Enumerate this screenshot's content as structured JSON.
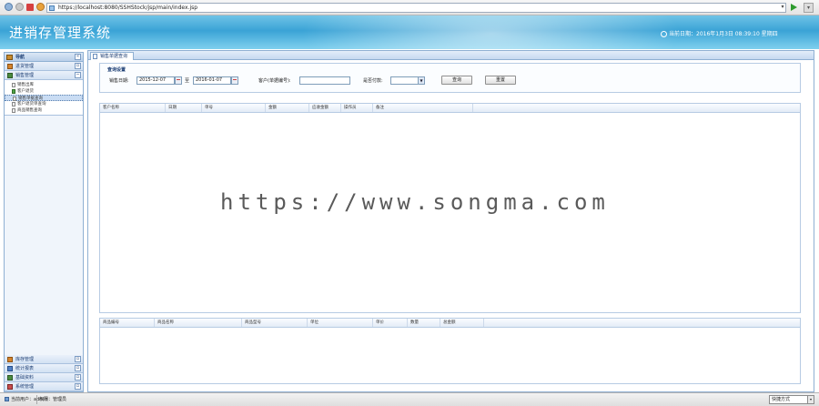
{
  "browser": {
    "url": "https://localhost:8080/SSHStock/jsp/main/index.jsp",
    "dropdown_glyph": "▾",
    "tools_glyph": "▾"
  },
  "header": {
    "title": "进销存管理系统",
    "date_text": "当前日期：2016年1月3日 08:39:10 星期四"
  },
  "sidebar": {
    "title": "导航",
    "collapse_glyph": "«",
    "groups_top": [
      {
        "label": "进货管理",
        "toggle": "▫"
      },
      {
        "label": "销售管理",
        "toggle": "−"
      }
    ],
    "sales_items": [
      {
        "label": "销售出库"
      },
      {
        "label": "客户退货"
      },
      {
        "label": "销售单据查询"
      },
      {
        "label": "客户退货单查询"
      },
      {
        "label": "商品销售查询"
      }
    ],
    "groups_bottom": [
      {
        "label": "库存管理",
        "toggle": "▫"
      },
      {
        "label": "统计报表",
        "toggle": "▫"
      },
      {
        "label": "基础资料",
        "toggle": "▫"
      },
      {
        "label": "系统管理",
        "toggle": "▫"
      }
    ]
  },
  "main": {
    "tab_label": "销售单据查询",
    "query": {
      "legend": "查询设置",
      "date_label": "销售日期:",
      "date_from": "2015-12-07",
      "date_sep": "至",
      "date_to": "2016-01-07",
      "customer_label": "客户(单据编号):",
      "customer_value": "",
      "status_label": "是否付款:",
      "status_value": "",
      "search_button": "查询",
      "reset_button": "重置"
    },
    "grid_top_columns": [
      "客户名称",
      "日期",
      "单号",
      "金额",
      "应收金额",
      "操作员",
      "备注"
    ],
    "grid_bottom_columns": [
      "商品编号",
      "商品名称",
      "商品型号",
      "单位",
      "单价",
      "数量",
      "总金额"
    ]
  },
  "watermark": "https://www.songma.com",
  "status": {
    "user_text": "当前用户：admin",
    "role_text": "权限：管理员",
    "zoom_label": "快捷方式",
    "zoom_arrow": "▾"
  }
}
